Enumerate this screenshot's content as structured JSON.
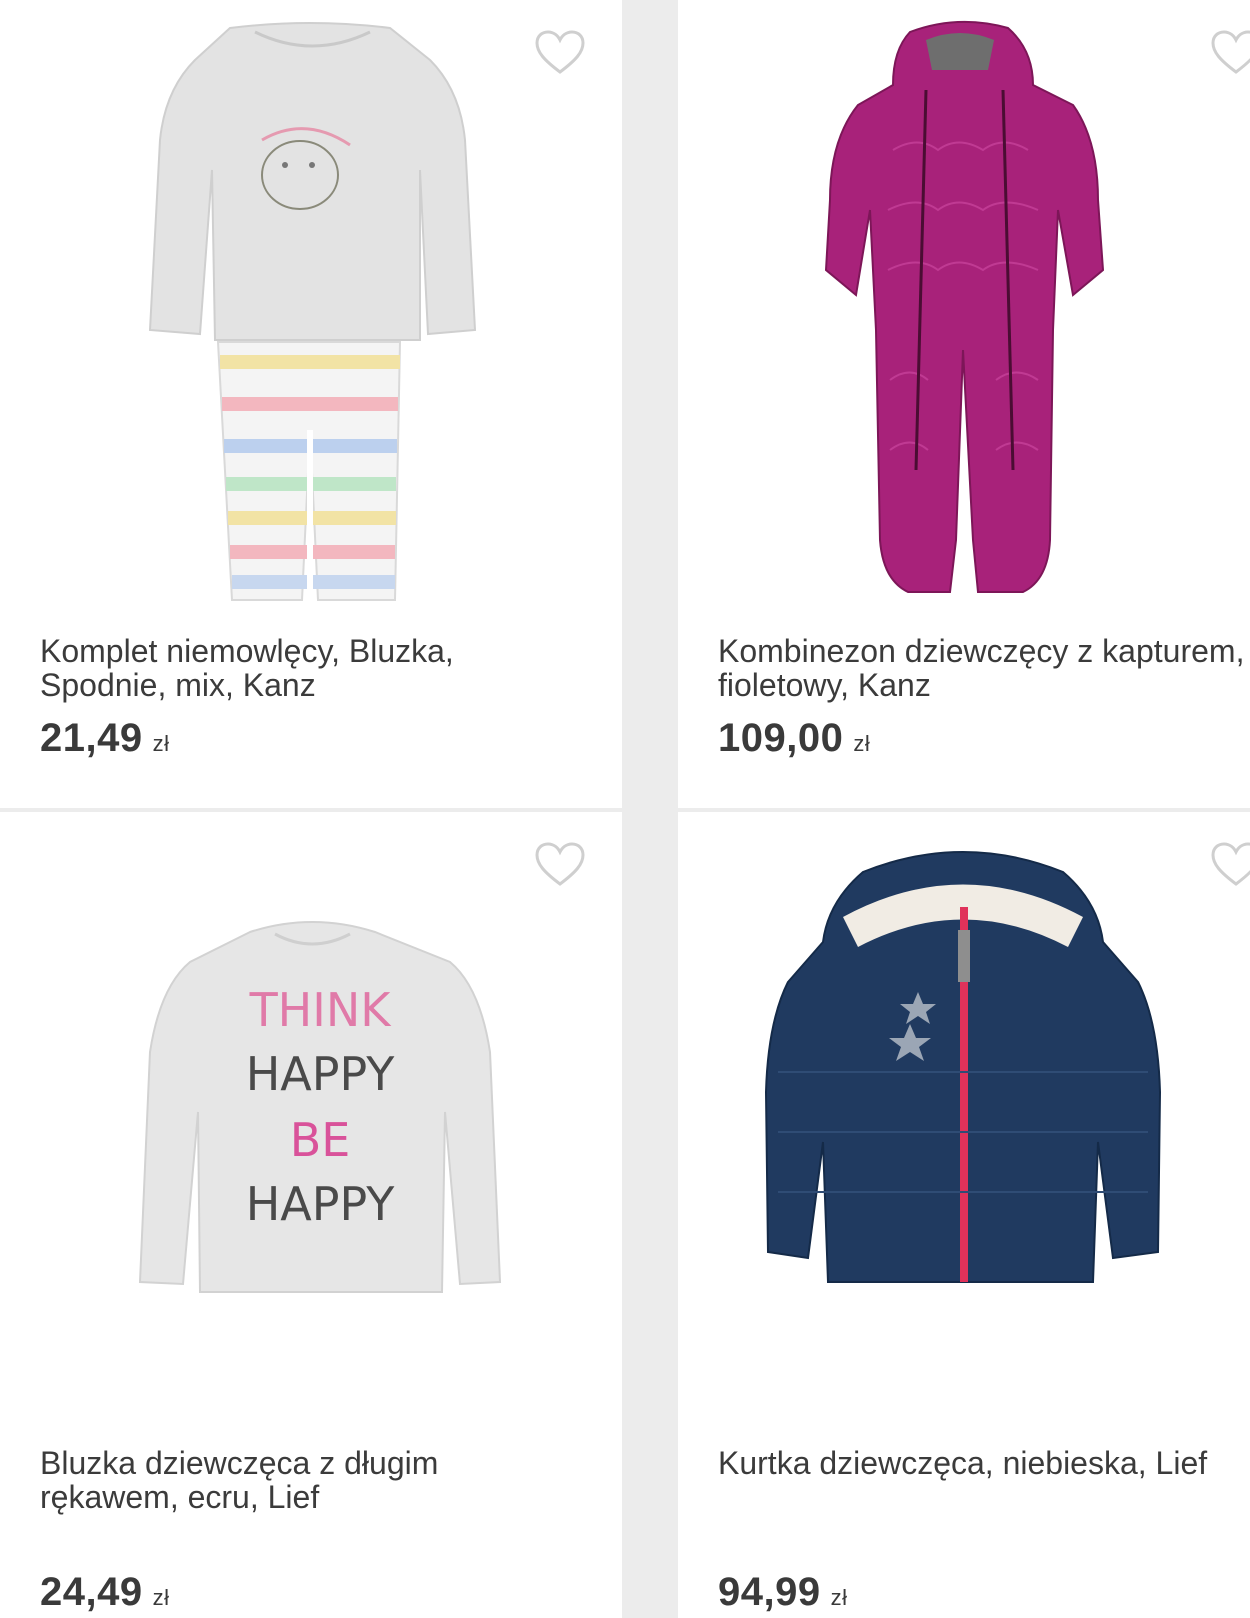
{
  "colors": {
    "background": "#ececec",
    "card": "#ffffff",
    "text": "#3a3a3a",
    "heart": "#cfcfcf"
  },
  "products": [
    {
      "title": "Komplet niemowlęcy, Bluzka, Spodnie, mix, Kanz",
      "price": "21,49",
      "currency": "zł",
      "favorite_icon": "heart-outline-icon"
    },
    {
      "title": "Kombinezon dziewczęcy z kapturem, fioletowy, Kanz",
      "price": "109,00",
      "currency": "zł",
      "favorite_icon": "heart-outline-icon"
    },
    {
      "title": "Bluzka dziewczęca z długim rękawem, ecru, Lief",
      "price": "24,49",
      "currency": "zł",
      "favorite_icon": "heart-outline-icon",
      "print_text": [
        "THINK",
        "HAPPY",
        "BE",
        "HAPPY"
      ]
    },
    {
      "title": "Kurtka dziewczęca, niebieska, Lief",
      "price": "94,99",
      "currency": "zł",
      "favorite_icon": "heart-outline-icon"
    }
  ]
}
